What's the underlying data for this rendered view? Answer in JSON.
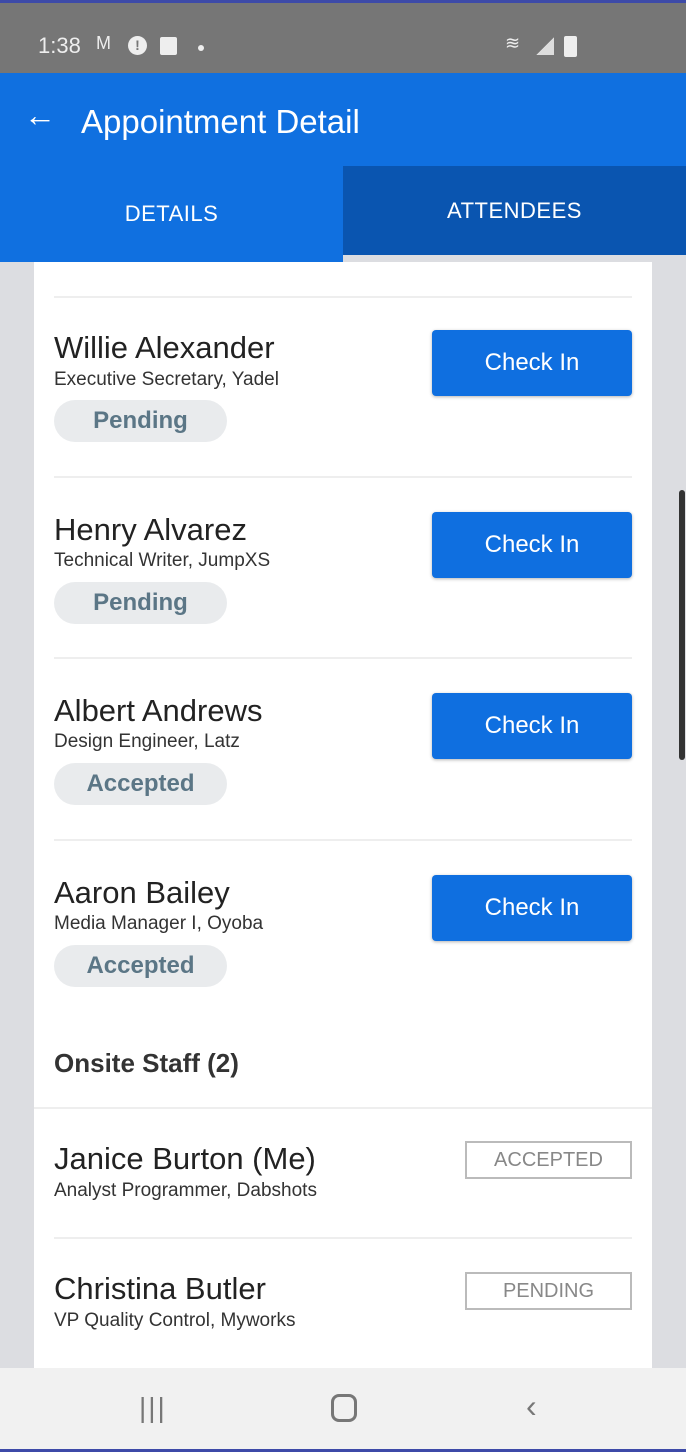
{
  "status_bar": {
    "time": "1:38"
  },
  "app_bar": {
    "title": "Appointment Detail"
  },
  "tabs": [
    {
      "label": "DETAILS",
      "active": false
    },
    {
      "label": "ATTENDEES",
      "active": true
    }
  ],
  "colors": {
    "primary": "#1070e0",
    "tab_active": "#0a55b0",
    "pill_bg": "#e9ebed"
  },
  "attendees": [
    {
      "name": "Willie Alexander",
      "title": "Executive Secretary, Yadel",
      "status": "Pending",
      "action": "Check In"
    },
    {
      "name": "Henry Alvarez",
      "title": "Technical Writer, JumpXS",
      "status": "Pending",
      "action": "Check In"
    },
    {
      "name": "Albert Andrews",
      "title": "Design Engineer, Latz",
      "status": "Accepted",
      "action": "Check In"
    },
    {
      "name": "Aaron Bailey",
      "title": "Media Manager I, Oyoba",
      "status": "Accepted",
      "action": "Check In"
    }
  ],
  "onsite_staff": {
    "heading": "Onsite Staff (2)",
    "items": [
      {
        "name": "Janice Burton (Me)",
        "title": "Analyst Programmer, Dabshots",
        "status": "ACCEPTED"
      },
      {
        "name": "Christina Butler",
        "title": "VP Quality Control, Myworks",
        "status": "PENDING"
      }
    ]
  }
}
